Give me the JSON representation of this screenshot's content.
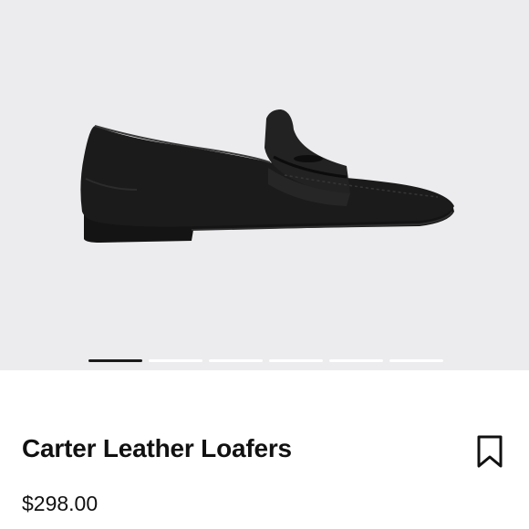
{
  "product": {
    "image_label": "black-leather-penny-loafer",
    "gallery_count": 6,
    "gallery_active_index": 0,
    "name": "Carter Leather Loafers",
    "price": "$298.00"
  },
  "actions": {
    "bookmark_icon": "bookmark-icon"
  },
  "colors": {
    "hero_bg": "#ececee",
    "text": "#111111",
    "pager_active": "#1a1a1a",
    "pager_inactive": "#ffffff"
  }
}
